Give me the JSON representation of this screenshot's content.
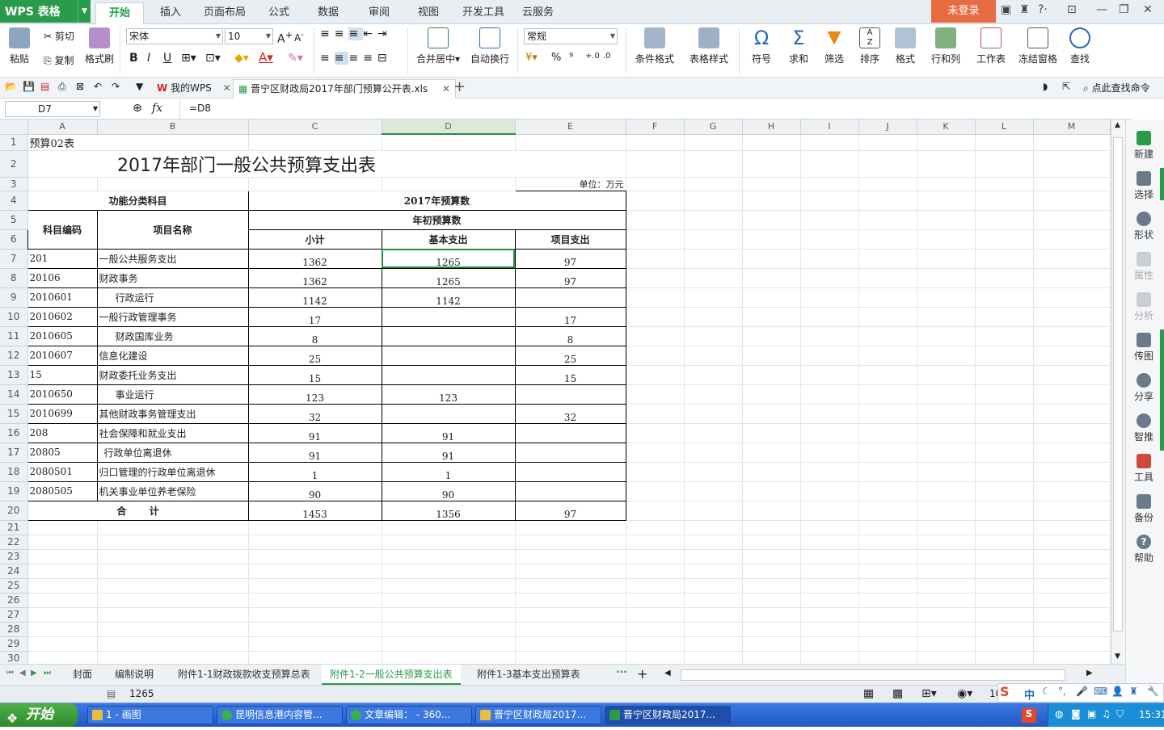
{
  "app": {
    "name": "WPS 表格",
    "login": "未登录"
  },
  "menu_tabs": [
    "开始",
    "插入",
    "页面布局",
    "公式",
    "数据",
    "审阅",
    "视图",
    "开发工具",
    "云服务"
  ],
  "ribbon": {
    "paste": "粘贴",
    "cut": "剪切",
    "copy": "复制",
    "format_painter": "格式刷",
    "font_name": "宋体",
    "font_size": "10",
    "bold": "B",
    "italic": "I",
    "underline": "U",
    "merge_center": "合并居中",
    "wrap_text": "自动换行",
    "number_format": "常规",
    "percent": "%",
    "comma": "⁹",
    "inc_dec": ".0",
    "cond_format": "条件格式",
    "table_style": "表格样式",
    "symbol": "符号",
    "sum": "求和",
    "filter": "筛选",
    "sort": "排序",
    "format": "格式",
    "rowcol": "行和列",
    "worksheet": "工作表",
    "freeze": "冻结窗格",
    "find": "查找"
  },
  "quickbar": {
    "doc_tabs": [
      "我的WPS",
      "晋宁区财政局2017年部门预算公开表.xls"
    ],
    "help_search": "点此查找命令"
  },
  "formula_bar": {
    "cell_ref": "D7",
    "fx": "fx",
    "formula": "=D8"
  },
  "columns": [
    "A",
    "B",
    "C",
    "D",
    "E",
    "F",
    "G",
    "H",
    "I",
    "J",
    "K",
    "L",
    "M"
  ],
  "sheet": {
    "r1_label": "预算02表",
    "title": "2017年部门一般公共预算支出表",
    "unit": "单位：万元",
    "hdr_func": "功能分类科目",
    "hdr_budget": "2017年预算数",
    "hdr_initial": "年初预算数",
    "hdr_code": "科目编码",
    "hdr_name": "项目名称",
    "hdr_subtotal": "小计",
    "hdr_basic": "基本支出",
    "hdr_project": "项目支出",
    "rows": [
      {
        "code": "201",
        "name": "一般公共服务支出",
        "subtotal": "1362",
        "basic": "1265",
        "project": "97"
      },
      {
        "code": "20106",
        "name": "财政事务",
        "subtotal": "1362",
        "basic": "1265",
        "project": "97"
      },
      {
        "code": "2010601",
        "name": "行政运行",
        "subtotal": "1142",
        "basic": "1142",
        "project": ""
      },
      {
        "code": "2010602",
        "name": "一般行政管理事务",
        "subtotal": "17",
        "basic": "",
        "project": "17"
      },
      {
        "code": "2010605",
        "name": "财政国库业务",
        "subtotal": "8",
        "basic": "",
        "project": "8"
      },
      {
        "code": "2010607",
        "name": "信息化建设",
        "subtotal": "25",
        "basic": "",
        "project": "25"
      },
      {
        "code": "15",
        "name": "财政委托业务支出",
        "subtotal": "15",
        "basic": "",
        "project": "15"
      },
      {
        "code": "2010650",
        "name": "事业运行",
        "subtotal": "123",
        "basic": "123",
        "project": ""
      },
      {
        "code": "2010699",
        "name": "其他财政事务管理支出",
        "subtotal": "32",
        "basic": "",
        "project": "32"
      },
      {
        "code": "208",
        "name": "社会保障和就业支出",
        "subtotal": "91",
        "basic": "91",
        "project": ""
      },
      {
        "code": "20805",
        "name": "行政单位离退休",
        "subtotal": "91",
        "basic": "91",
        "project": ""
      },
      {
        "code": "2080501",
        "name": "归口管理的行政单位离退休",
        "subtotal": "1",
        "basic": "1",
        "project": ""
      },
      {
        "code": "2080505",
        "name": "机关事业单位养老保险",
        "subtotal": "90",
        "basic": "90",
        "project": ""
      }
    ],
    "total_label": "合 计",
    "total": {
      "subtotal": "1453",
      "basic": "1356",
      "project": "97"
    }
  },
  "right_panel": [
    "新建",
    "选择",
    "形状",
    "属性",
    "分析",
    "传图",
    "分享",
    "智推",
    "工具",
    "备份",
    "帮助"
  ],
  "sheet_tabs": [
    "封面",
    "编制说明",
    "附件1-1财政拨款收支预算总表",
    "附件1-2一般公共预算支出表",
    "附件1-3基本支出预算表"
  ],
  "status": {
    "value": "1265",
    "zoom": "10"
  },
  "taskbar": {
    "start": "开始",
    "tasks": [
      "1 - 画图",
      "昆明信息港内容管...",
      "文章编辑： - 360...",
      "晋宁区财政局2017...",
      "晋宁区财政局2017..."
    ],
    "time": "15:31",
    "ime_mode": "中"
  }
}
